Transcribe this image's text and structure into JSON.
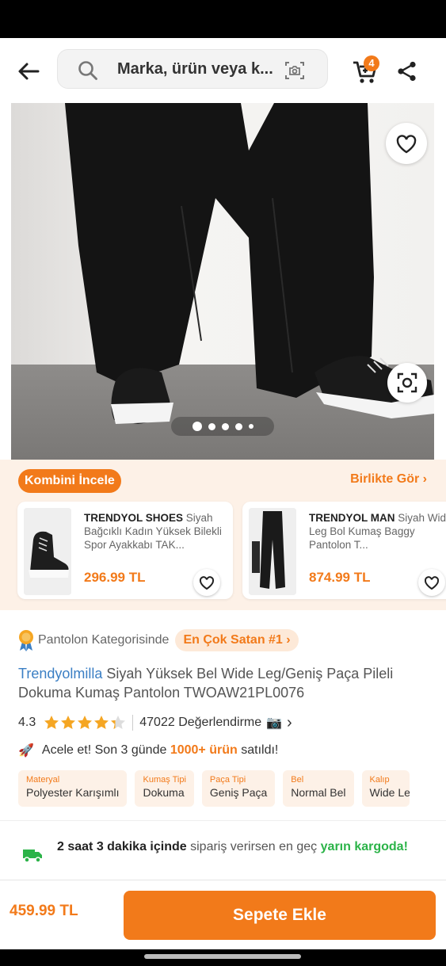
{
  "header": {
    "search_placeholder": "Marka, ürün veya k...",
    "cart_count": "4"
  },
  "gallery": {
    "image_count": 5,
    "active_index": 0
  },
  "kombin": {
    "title": "Kombini İncele",
    "see_together": "Birlikte Gör",
    "items": [
      {
        "brand": "TRENDYOL SHOES",
        "name": "Siyah Bağcıklı Kadın Yüksek Bilekli Spor Ayakkabı TAK...",
        "price": "296.99 TL"
      },
      {
        "brand": "TRENDYOL MAN",
        "name": "Siyah Wide Leg Bol Kumaş Baggy Pantolon T...",
        "price": "874.99 TL"
      }
    ]
  },
  "product": {
    "rank_text": "Pantolon Kategorisinde",
    "rank_badge": "En Çok Satan #1",
    "brand": "Trendyolmilla",
    "title": "Siyah Yüksek Bel Wide Leg/Geniş Paça Pileli Dokuma Kumaş Pantolon TWOAW21PL0076",
    "rating": "4.3",
    "rating_value": 4.3,
    "review_count": "47022 Değerlendirme",
    "urgency_prefix": "Acele et! Son 3 günde",
    "urgency_highlight": "1000+ ürün",
    "urgency_suffix": "satıldı!",
    "attributes": [
      {
        "label": "Materyal",
        "value": "Polyester Karışımlı"
      },
      {
        "label": "Kumaş Tipi",
        "value": "Dokuma"
      },
      {
        "label": "Paça Tipi",
        "value": "Geniş Paça"
      },
      {
        "label": "Bel",
        "value": "Normal Bel"
      },
      {
        "label": "Kalıp",
        "value": "Wide Leg"
      }
    ]
  },
  "delivery": {
    "bold": "2 saat 3 dakika içinde",
    "middle": "sipariş verirsen en geç",
    "green": "yarın kargoda!"
  },
  "bottom": {
    "price": "459.99 TL",
    "add_to_cart": "Sepete Ekle"
  },
  "colors": {
    "accent": "#f27a1a",
    "brand_link": "#3b7fc4",
    "delivery_green": "#2bb348"
  }
}
